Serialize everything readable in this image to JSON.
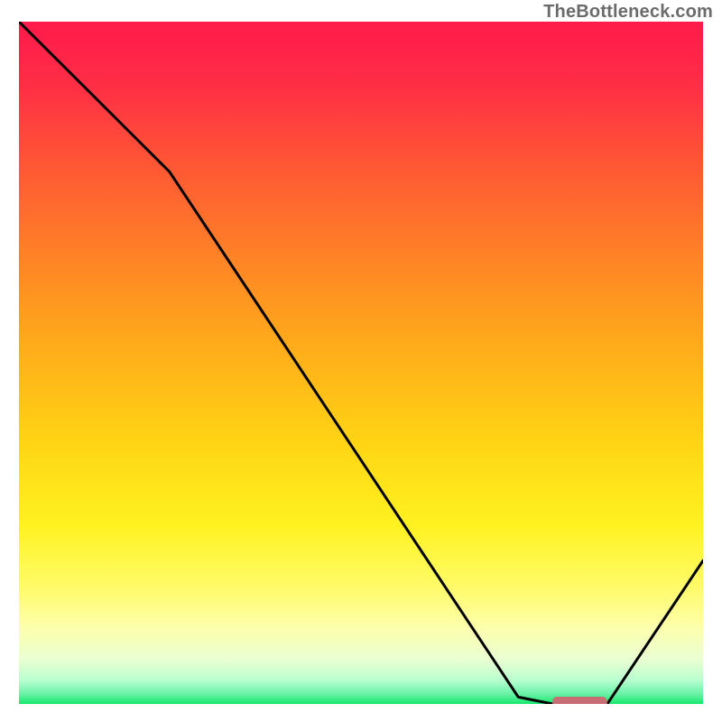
{
  "watermark": "TheBottleneck.com",
  "chart_data": {
    "type": "line",
    "title": "",
    "xlabel": "",
    "ylabel": "",
    "xlim": [
      0,
      100
    ],
    "ylim": [
      0,
      100
    ],
    "grid": false,
    "legend": false,
    "gradient_stops": [
      {
        "offset": 0,
        "color": "#ff1a4b"
      },
      {
        "offset": 0.09,
        "color": "#ff2d46"
      },
      {
        "offset": 0.22,
        "color": "#ff5a33"
      },
      {
        "offset": 0.35,
        "color": "#ff8425"
      },
      {
        "offset": 0.48,
        "color": "#ffad1a"
      },
      {
        "offset": 0.62,
        "color": "#ffd514"
      },
      {
        "offset": 0.74,
        "color": "#fff221"
      },
      {
        "offset": 0.83,
        "color": "#fffb6a"
      },
      {
        "offset": 0.89,
        "color": "#fdffae"
      },
      {
        "offset": 0.935,
        "color": "#e9ffd2"
      },
      {
        "offset": 0.965,
        "color": "#b9ffcf"
      },
      {
        "offset": 0.985,
        "color": "#6bf2a8"
      },
      {
        "offset": 1.0,
        "color": "#17e86c"
      }
    ],
    "series": [
      {
        "name": "bottleneck-curve",
        "x": [
          0,
          22,
          73,
          78,
          86,
          100
        ],
        "y": [
          100,
          78,
          1,
          0,
          0,
          21
        ]
      }
    ],
    "marker": {
      "name": "optimal-range",
      "x_start": 78,
      "x_end": 86,
      "y": 0,
      "color": "#c76d73"
    }
  }
}
